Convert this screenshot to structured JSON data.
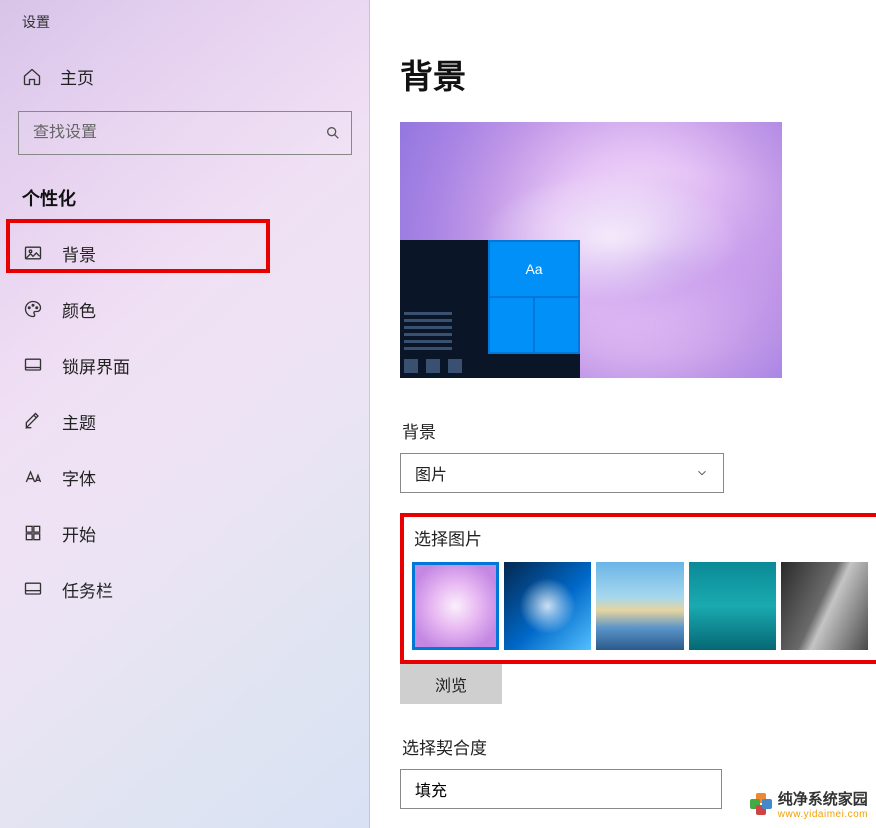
{
  "app_title": "设置",
  "home_label": "主页",
  "search_placeholder": "查找设置",
  "section_label": "个性化",
  "nav": [
    {
      "label": "背景"
    },
    {
      "label": "颜色"
    },
    {
      "label": "锁屏界面"
    },
    {
      "label": "主题"
    },
    {
      "label": "字体"
    },
    {
      "label": "开始"
    },
    {
      "label": "任务栏"
    }
  ],
  "main_title": "背景",
  "preview_tile_text": "Aa",
  "bg_field_label": "背景",
  "bg_dropdown_value": "图片",
  "choose_image_label": "选择图片",
  "browse_label": "浏览",
  "fit_label": "选择契合度",
  "fit_value": "填充",
  "watermark": {
    "line1": "纯净系统家园",
    "line2": "www.yidaimei.com"
  }
}
